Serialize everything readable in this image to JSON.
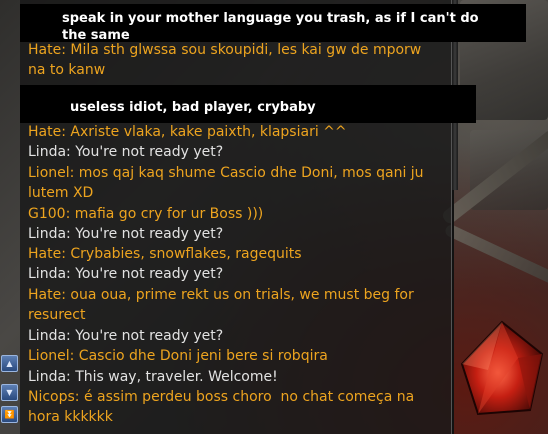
{
  "banners": {
    "top_line1": "speak in your mother language you trash, as if I can't do",
    "top_line2": "the same",
    "second": "useless idiot, bad player, crybaby"
  },
  "chat": [
    {
      "text": "Hate: Mila sth glwssa sou skoupidi, les kai gw de mporw",
      "color": "orange"
    },
    {
      "text": "na to kanw",
      "color": "orange"
    },
    {
      "text": "Hate: Axriste vlaka, kake paixth, klapsiari ^^",
      "color": "orange"
    },
    {
      "text": "Linda: You're not ready yet?",
      "color": "white"
    },
    {
      "text": "Lionel: mos qaj kaq shume Cascio dhe Doni, mos qani ju",
      "color": "orange"
    },
    {
      "text": "lutem XD",
      "color": "orange"
    },
    {
      "text": "G100: mafia go cry for ur Boss )))",
      "color": "orange"
    },
    {
      "text": "Linda: You're not ready yet?",
      "color": "white"
    },
    {
      "text": "Hate: Crybabies, snowflakes, ragequits",
      "color": "orange"
    },
    {
      "text": "Linda: You're not ready yet?",
      "color": "white"
    },
    {
      "text": "Hate: oua oua, prime rekt us on trials, we must beg for",
      "color": "orange"
    },
    {
      "text": "resurect",
      "color": "orange"
    },
    {
      "text": "Linda: You're not ready yet?",
      "color": "white"
    },
    {
      "text": "Lionel: Cascio dhe Doni jeni bere si robqira",
      "color": "orange"
    },
    {
      "text": "Linda: This way, traveler. Welcome!",
      "color": "white"
    },
    {
      "text": "Nicops: é assim perdeu boss choro  no chat começa na",
      "color": "orange"
    },
    {
      "text": "hora kkkkkk",
      "color": "orange"
    }
  ],
  "icons": {
    "scroll_up": "chevron-up-icon",
    "scroll_down": "chevron-down-icon",
    "scroll_bottom": "double-chevron-down-icon"
  },
  "colors": {
    "orange_text": "#eda41f",
    "white_text": "#e2e2e2"
  }
}
